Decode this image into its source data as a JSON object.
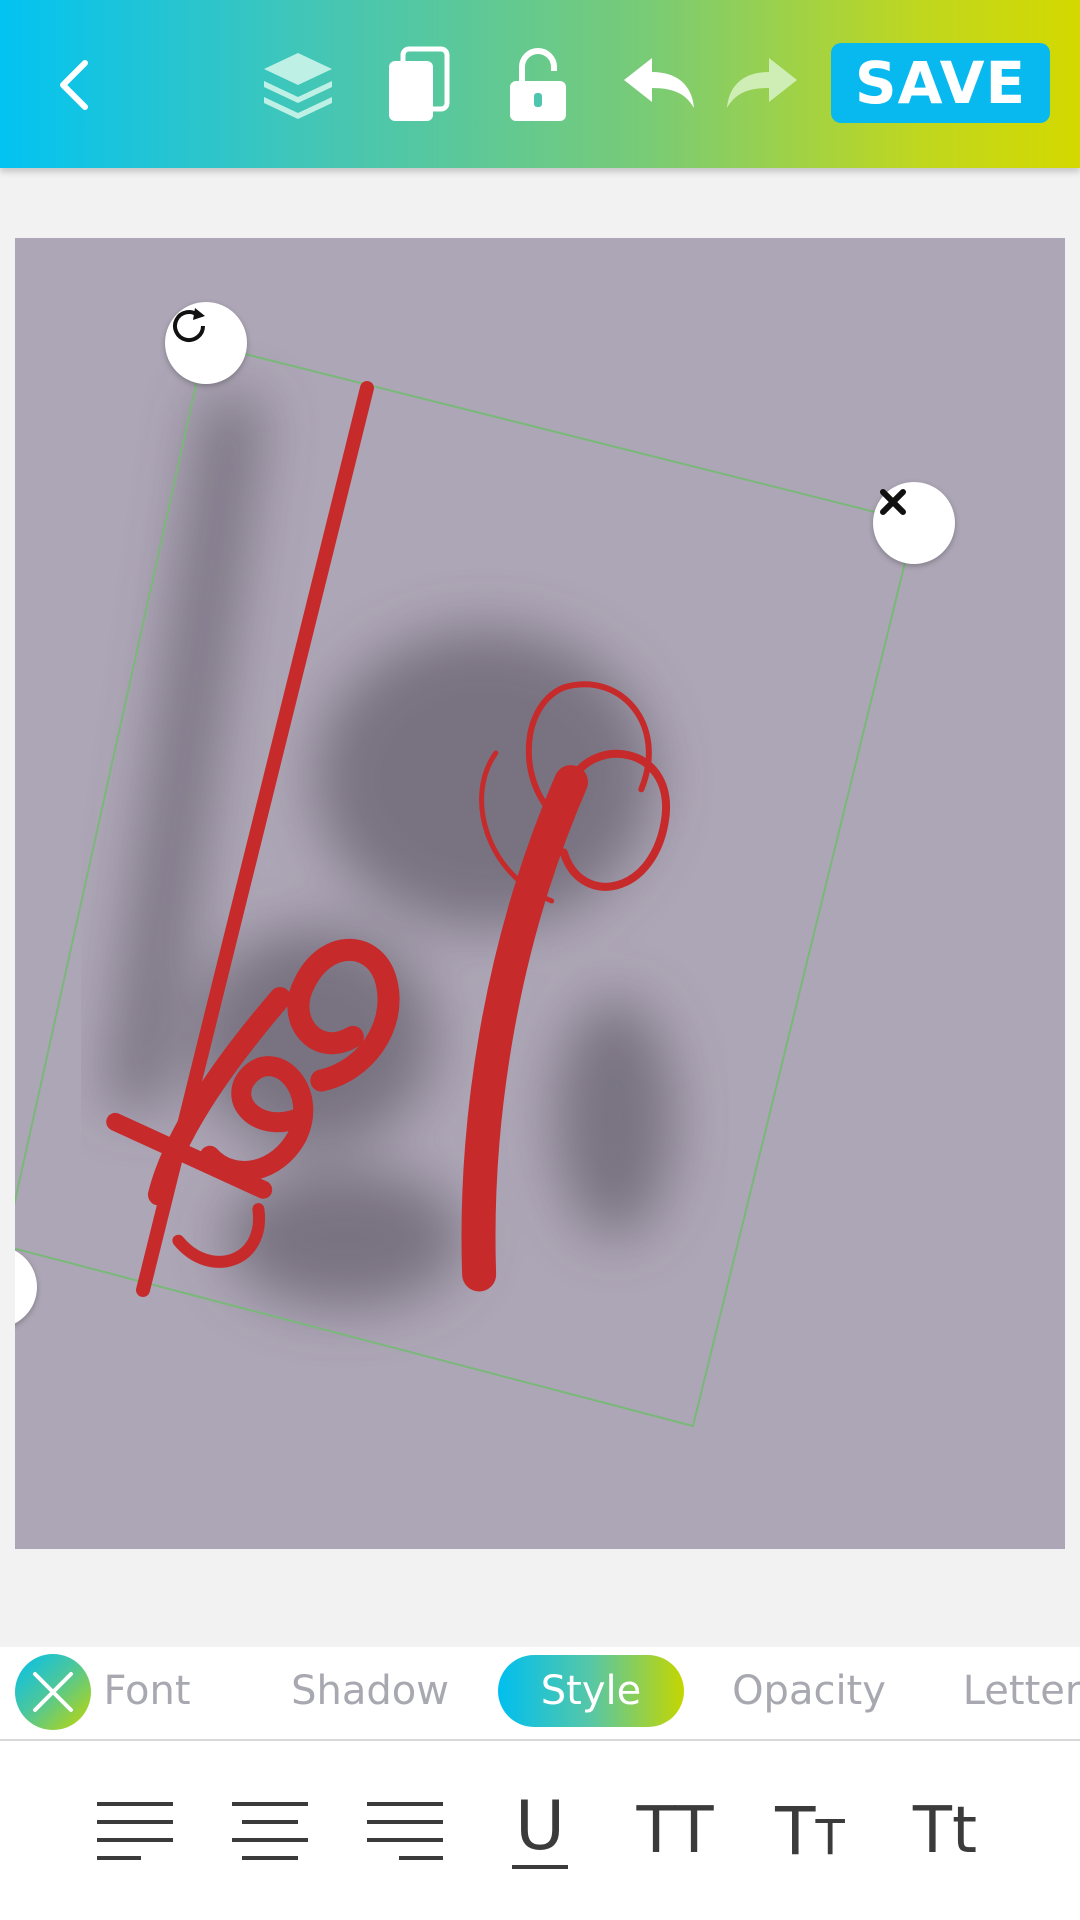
{
  "toolbar": {
    "save_label": "SAVE",
    "icons": [
      "back-arrow-icon",
      "layers-icon",
      "duplicate-icon",
      "unlock-icon",
      "undo-icon",
      "redo-icon"
    ]
  },
  "canvas": {
    "background": "#ada6b6",
    "text_layer": {
      "text": "Test",
      "color": "#c62a2a",
      "style": "script, underlined, rotated, drop shadow"
    }
  },
  "tabs": [
    {
      "label": "Font",
      "active": false
    },
    {
      "label": "Shadow",
      "active": false
    },
    {
      "label": "Style",
      "active": true
    },
    {
      "label": "Opacity",
      "active": false
    },
    {
      "label": "Letter",
      "active": false
    }
  ],
  "style_options": {
    "underline_glyph": "U",
    "all_caps_glyph": "TT",
    "small_caps_glyph": "TT",
    "title_case_glyph": "Tt"
  },
  "colors": {
    "gradient_start": "#02c3f2",
    "gradient_end": "#d4d800",
    "save_button": "#08b9f0",
    "text_red": "#c62a2a"
  }
}
